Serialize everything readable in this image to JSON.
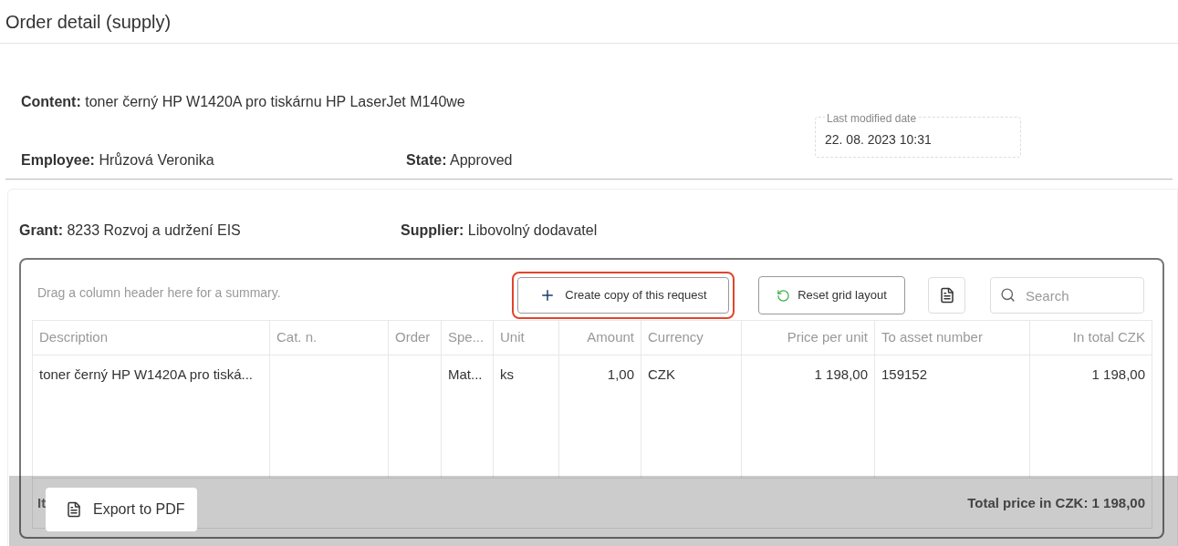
{
  "page_title": "Order detail (supply)",
  "fields": [
    {
      "label": "Content:",
      "value": "toner černý HP W1420A pro tiskárnu HP LaserJet M140we"
    },
    {
      "label": "Employee:",
      "value": "Hrůzová Veronika"
    },
    {
      "label": "State:",
      "value": "Approved"
    }
  ],
  "last_modified": {
    "label": "Last modified date",
    "value": "22. 08. 2023 10:31"
  },
  "grant": {
    "label": "Grant:",
    "value": "8233 Rozvoj a udržení EIS"
  },
  "supplier": {
    "label": "Supplier:",
    "value": "Libovolný dodavatel"
  },
  "grid": {
    "group_hint": "Drag a column header here for a summary.",
    "create_copy_button": {
      "label": "Create copy of this request",
      "highlighted": true
    },
    "reset_button": "Reset grid layout",
    "search": {
      "placeholder": "Search"
    },
    "columns": [
      "Description",
      "Cat. n.",
      "Order",
      "Spe...",
      "Unit",
      "Amount",
      "Currency",
      "Price per unit",
      "To asset number",
      "In total CZK"
    ],
    "rows": [
      [
        "toner černý HP W1420A pro tiská...",
        "",
        "",
        "Mat...",
        "ks",
        "1,00",
        "CZK",
        "1 198,00",
        "159152",
        "1 198,00"
      ]
    ],
    "items_total": "It",
    "total_price": "Total price in CZK: 1 198,00"
  },
  "export_button": "Export to PDF"
}
